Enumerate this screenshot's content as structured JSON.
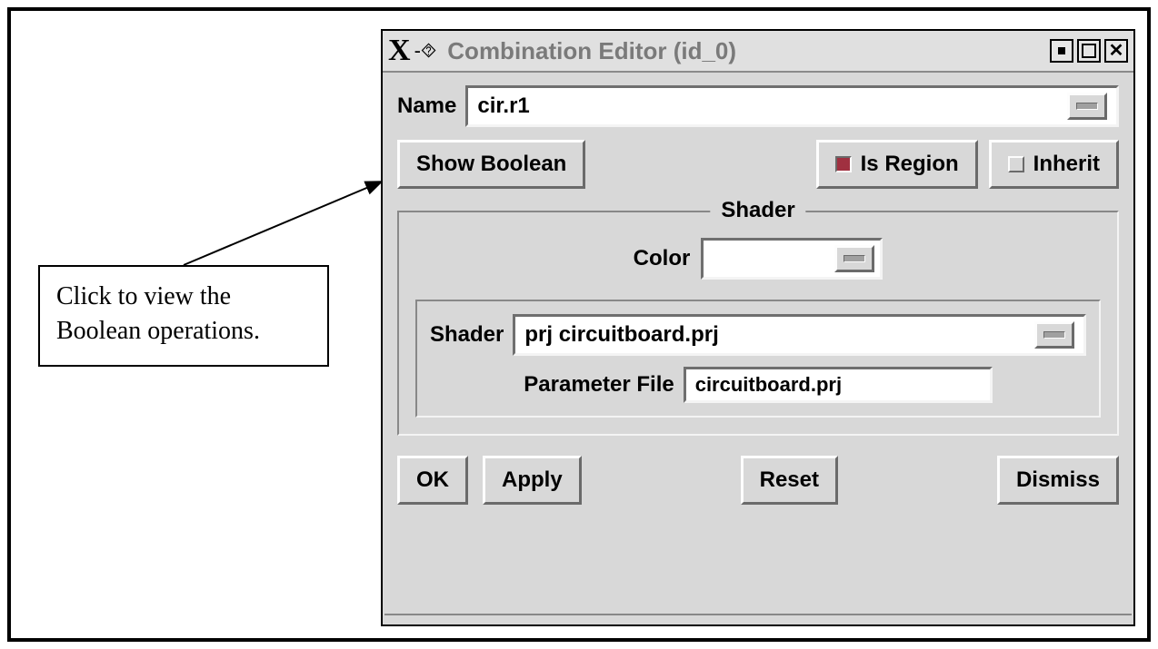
{
  "callout": {
    "text": "Click to view the Boolean operations."
  },
  "window": {
    "title": "Combination Editor (id_0)"
  },
  "name_row": {
    "label": "Name",
    "value": "cir.r1"
  },
  "toolbar": {
    "show_boolean": "Show Boolean",
    "is_region": "Is Region",
    "inherit": "Inherit"
  },
  "shader_group": {
    "title": "Shader",
    "color_label": "Color",
    "shader_label": "Shader",
    "shader_value": "prj circuitboard.prj",
    "param_label": "Parameter File",
    "param_value": "circuitboard.prj"
  },
  "buttons": {
    "ok": "OK",
    "apply": "Apply",
    "reset": "Reset",
    "dismiss": "Dismiss"
  }
}
